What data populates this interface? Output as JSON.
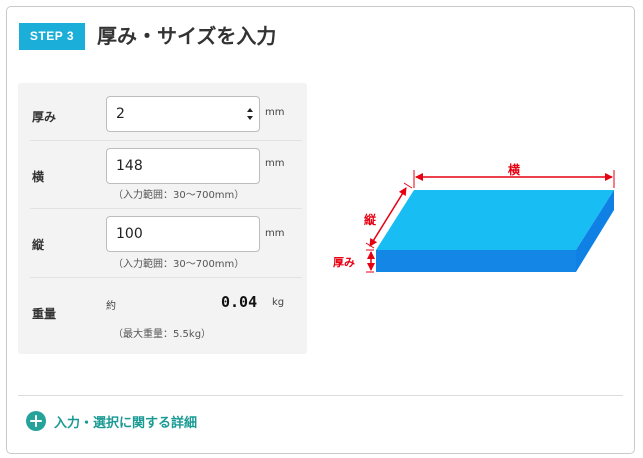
{
  "header": {
    "step_badge": "STEP 3",
    "title": "厚み・サイズを入力"
  },
  "form": {
    "thickness": {
      "label": "厚み",
      "value": "2",
      "unit": "mm"
    },
    "width": {
      "label": "横",
      "value": "148",
      "unit": "mm",
      "hint": "（入力範囲：30～700mm）"
    },
    "length": {
      "label": "縦",
      "value": "100",
      "unit": "mm",
      "hint": "（入力範囲：30～700mm）"
    },
    "weight": {
      "label": "重量",
      "prefix": "約",
      "value": "0.04",
      "unit": "kg",
      "hint": "（最大重量：5.5kg）"
    }
  },
  "diagram": {
    "width_label": "横",
    "length_label": "縦",
    "thickness_label": "厚み",
    "colors": {
      "top": "#17bdf3",
      "side": "#0f80e4",
      "front": "#1487e6",
      "dimension": "#e60012"
    }
  },
  "footer": {
    "details_link": "入力・選択に関する詳細"
  }
}
